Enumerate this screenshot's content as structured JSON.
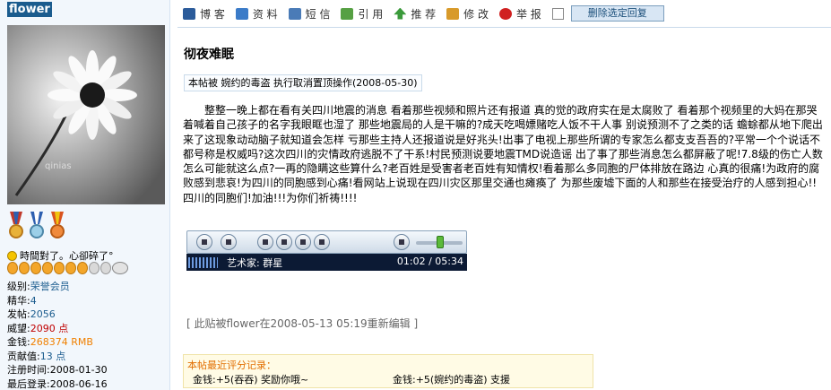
{
  "user": {
    "name": "flower",
    "avatar_caption": "qinias",
    "status_text": "時間對了。心卻碎了°",
    "profile": [
      {
        "label": "级别:",
        "value": "荣誉会员",
        "color": "blue"
      },
      {
        "label": "精华:",
        "value": "4",
        "color": "blue"
      },
      {
        "label": "发帖:",
        "value": "2056",
        "color": "blue"
      },
      {
        "label": "威望:",
        "value": "2090 点",
        "color": "red"
      },
      {
        "label": "金钱:",
        "value": "268374 RMB",
        "color": "orange"
      },
      {
        "label": "贡献值:",
        "value": "13 点",
        "color": "blue"
      },
      {
        "label": "注册时间:",
        "value": "2008-01-30",
        "color": "none"
      },
      {
        "label": "最后登录:",
        "value": "2008-06-16",
        "color": "none"
      }
    ]
  },
  "toolbar": {
    "items": [
      {
        "label": "博 客",
        "icon": "blog-icon",
        "color": "#2b5b9a"
      },
      {
        "label": "资 料",
        "icon": "profile-icon",
        "color": "#3b7bc8"
      },
      {
        "label": "短 信",
        "icon": "message-icon",
        "color": "#4a7bb7"
      },
      {
        "label": "引 用",
        "icon": "quote-icon",
        "color": "#56a043"
      },
      {
        "label": "推 荐",
        "icon": "recommend-icon",
        "color": "#3b9a3b"
      },
      {
        "label": "修 改",
        "icon": "edit-icon",
        "color": "#d89a2a"
      },
      {
        "label": "举 报",
        "icon": "report-icon",
        "color": "#d02020"
      }
    ],
    "delete_button": "删除选定回复"
  },
  "post": {
    "title": "彻夜难眠",
    "notice": "本帖被 婉约的毒盗 执行取消置顶操作(2008-05-30)",
    "body": "整整一晚上都在看有关四川地震的消息 看着那些视频和照片还有报道 真的觉的政府实在是太腐败了 看着那个视频里的大妈在那哭着喊着自己孩子的名字我眼眶也湿了 那些地震局的人是干嘛的?成天吃喝嫖赌吃人饭不干人事 别说预测不了之类的话 蟾蜍都从地下爬出来了这现象动动脑子就知道会怎样 亏那些主持人还报道说是好兆头!出事了电视上那些所谓的专家怎么都支支吾吾的?平常一个个说话不都号称是权威吗?这次四川的灾情政府逃脱不了干系!村民预测说要地震TMD说造谣 出了事了那些消息怎么都屏蔽了呢!7.8级的伤亡人数怎么可能就这么点?一再的隐瞒这些算什么?老百姓是受害者老百姓有知情权!看着那么多同胞的尸体排放在路边 心真的很痛!为政府的腐败感到悲哀!为四川的同胞感到心痛!看网站上说现在四川灾区那里交通也瘫痪了 为那些废墟下面的人和那些在接受治疗的人感到担心!!四川的同胞们!加油!!!为你们祈祷!!!!",
    "edit_note": "[ 此贴被flower在2008-05-13 05:19重新编辑 ]"
  },
  "player": {
    "artist": "艺术家:  群星",
    "time": "01:02 / 05:34"
  },
  "ratings": {
    "title": "本帖最近评分记录：",
    "entries": [
      "金钱:+5(吞吞) 奖励你哦~",
      "金钱:+5(婉约的毒盗) 支援"
    ]
  }
}
